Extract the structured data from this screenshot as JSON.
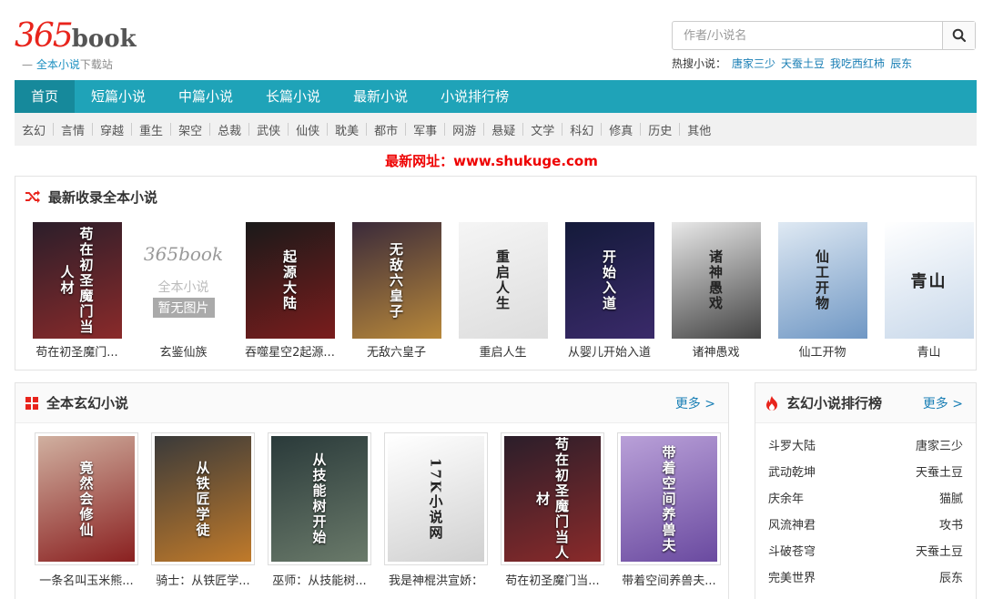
{
  "logo": {
    "main": "365",
    "book": "book",
    "sub_prefix": "— ",
    "sub_blue": "全本小说",
    "sub_gray": "下载站"
  },
  "search": {
    "placeholder": "作者/小说名",
    "button_icon": "search-icon"
  },
  "hot": {
    "label": "热搜小说：",
    "items": [
      "唐家三少",
      "天蚕土豆",
      "我吃西红柿",
      "辰东"
    ]
  },
  "nav": {
    "items": [
      "首页",
      "短篇小说",
      "中篇小说",
      "长篇小说",
      "最新小说",
      "小说排行榜"
    ],
    "active_index": 0
  },
  "categories": [
    "玄幻",
    "言情",
    "穿越",
    "重生",
    "架空",
    "总裁",
    "武侠",
    "仙侠",
    "耽美",
    "都市",
    "军事",
    "网游",
    "悬疑",
    "文学",
    "科幻",
    "修真",
    "历史",
    "其他"
  ],
  "notice": "最新网址：www.shukuge.com",
  "latest": {
    "title": "最新收录全本小说",
    "icon": "shuffle-icon",
    "books": [
      {
        "title": "苟在初圣魔门...",
        "cover_text": "苟在初圣魔门当人材",
        "color1": "#2b1e2a",
        "color2": "#8a2a2a"
      },
      {
        "title": "玄鉴仙族",
        "cover_text": "",
        "placeholder_logo": "365book",
        "placeholder_line1": "全本小说",
        "placeholder_line2": "暂无图片",
        "color1": "#ffffff",
        "color2": "#ffffff"
      },
      {
        "title": "吞噬星空2起源...",
        "cover_text": "起源大陆",
        "color1": "#1a1a1a",
        "color2": "#7a1c1c"
      },
      {
        "title": "无敌六皇子",
        "cover_text": "无敌六皇子",
        "color1": "#3a2a3a",
        "color2": "#b8883a"
      },
      {
        "title": "重启人生",
        "cover_text": "重启人生",
        "color1": "#f5f5f5",
        "color2": "#dddddd"
      },
      {
        "title": "从婴儿开始入道",
        "cover_text": "开始入道",
        "color1": "#141a3a",
        "color2": "#3a2a6a"
      },
      {
        "title": "诸神愚戏",
        "cover_text": "诸神愚戏",
        "color1": "#e8e8e8",
        "color2": "#444444"
      },
      {
        "title": "仙工开物",
        "cover_text": "仙工开物",
        "color1": "#dfe9f3",
        "color2": "#6f97c4"
      },
      {
        "title": "青山",
        "cover_text": "青山",
        "color1": "#ffffff",
        "color2": "#c8d8ea"
      }
    ]
  },
  "xuanhuan": {
    "title": "全本玄幻小说",
    "more": "更多 >",
    "icon": "grid-icon",
    "books": [
      {
        "title": "一条名叫玉米熊...",
        "cover_text": "竟然会修仙",
        "color1": "#d0b0a0",
        "color2": "#8a2020"
      },
      {
        "title": "骑士：从铁匠学...",
        "cover_text": "从铁匠学徒",
        "color1": "#3a3a3a",
        "color2": "#c07a2a"
      },
      {
        "title": "巫师：从技能树...",
        "cover_text": "从技能树开始",
        "color1": "#2a3a3a",
        "color2": "#6a7a6a"
      },
      {
        "title": "我是神棍洪宣娇：",
        "cover_text": "17K小说网",
        "color1": "#ffffff",
        "color2": "#d0d0d0"
      },
      {
        "title": "苟在初圣魔门当...",
        "cover_text": "苟在初圣魔门当人材",
        "color1": "#2b1e2a",
        "color2": "#8a2a2a"
      },
      {
        "title": "带着空间养兽夫...",
        "cover_text": "带着空间养兽夫",
        "color1": "#b9a0d8",
        "color2": "#6a4aa0"
      }
    ]
  },
  "rank": {
    "title": "玄幻小说排行榜",
    "more": "更多 >",
    "icon": "fire-icon",
    "items": [
      {
        "name": "斗罗大陆",
        "author": "唐家三少"
      },
      {
        "name": "武动乾坤",
        "author": "天蚕土豆"
      },
      {
        "name": "庆余年",
        "author": "猫腻"
      },
      {
        "name": "风流神君",
        "author": "攻书"
      },
      {
        "name": "斗破苍穹",
        "author": "天蚕土豆"
      },
      {
        "name": "完美世界",
        "author": "辰东"
      }
    ]
  },
  "colors": {
    "nav_bg": "#1fa3b8",
    "nav_active": "#16899b",
    "link": "#1a7fb5",
    "notice": "#ee0000",
    "icon_red": "#e8241c"
  }
}
